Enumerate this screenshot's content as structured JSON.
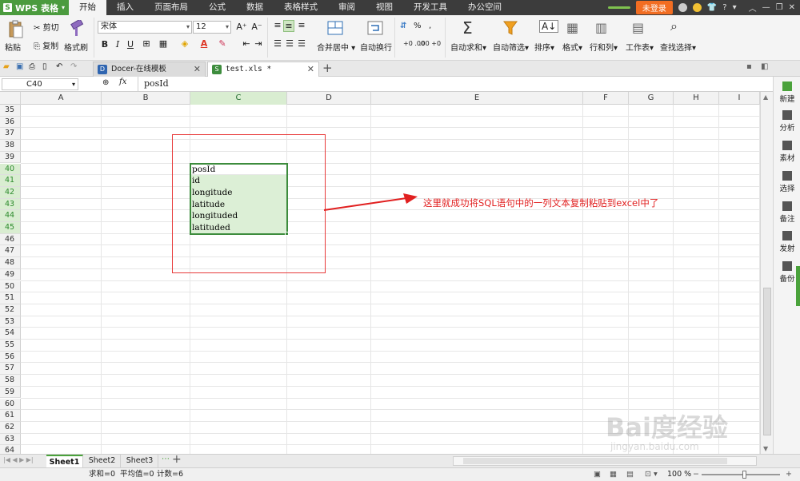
{
  "app": {
    "logo": "WPS 表格"
  },
  "menu": {
    "tabs": [
      "开始",
      "插入",
      "页面布局",
      "公式",
      "数据",
      "表格样式",
      "审阅",
      "视图",
      "开发工具",
      "办公空间"
    ],
    "active_tab": "开始",
    "login": "未登录",
    "help": "?"
  },
  "ribbon": {
    "paste": "粘贴",
    "cut": "剪切",
    "copy": "复制",
    "format_painter": "格式刷",
    "font_name": "宋体",
    "font_size": "12",
    "bold": "B",
    "italic": "I",
    "underline": "U",
    "merge_center": "合并居中",
    "wrap_text": "自动换行",
    "percent": "%",
    "autosum": "自动求和",
    "autofilter": "自动筛选",
    "sort": "排序",
    "format": "格式",
    "row_col": "行和列",
    "worksheet": "工作表",
    "find_select": "查找选择"
  },
  "doc_tabs": [
    {
      "label": "Docer-在线模板",
      "icon": "docer-icon"
    },
    {
      "label": "test.xls *",
      "icon": "xls-icon"
    }
  ],
  "formula_bar": {
    "cell_ref": "C40",
    "fx": "fx",
    "content": "posId"
  },
  "grid": {
    "columns": [
      "A",
      "B",
      "C",
      "D",
      "E",
      "F",
      "G",
      "H",
      "I"
    ],
    "rows": [
      "35",
      "36",
      "37",
      "38",
      "39",
      "40",
      "41",
      "42",
      "43",
      "44",
      "45",
      "46",
      "47",
      "48",
      "49",
      "50",
      "51",
      "52",
      "53",
      "54",
      "55",
      "56",
      "57",
      "58",
      "59",
      "60",
      "61",
      "62",
      "63",
      "64"
    ],
    "values": [
      "posId",
      "id",
      "longitude",
      "latitude",
      "longituded",
      "latituded"
    ]
  },
  "annotation": "这里就成功将SQL语句中的一列文本复制粘贴到excel中了",
  "task_pane": [
    "新建",
    "分析",
    "素材",
    "选择",
    "备注",
    "发射",
    "备份"
  ],
  "sheets": [
    "Sheet1",
    "Sheet2",
    "Sheet3"
  ],
  "status": {
    "sum": "求和=0",
    "avg": "平均值=0",
    "count": "计数=6",
    "zoom": "100 %"
  },
  "watermark": {
    "main": "Bai度经验",
    "sub": "jingyan.baidu.com"
  },
  "colors": {
    "accent_green": "#4aa23b",
    "annotation_red": "#e12020",
    "login_orange": "#f26d22"
  }
}
